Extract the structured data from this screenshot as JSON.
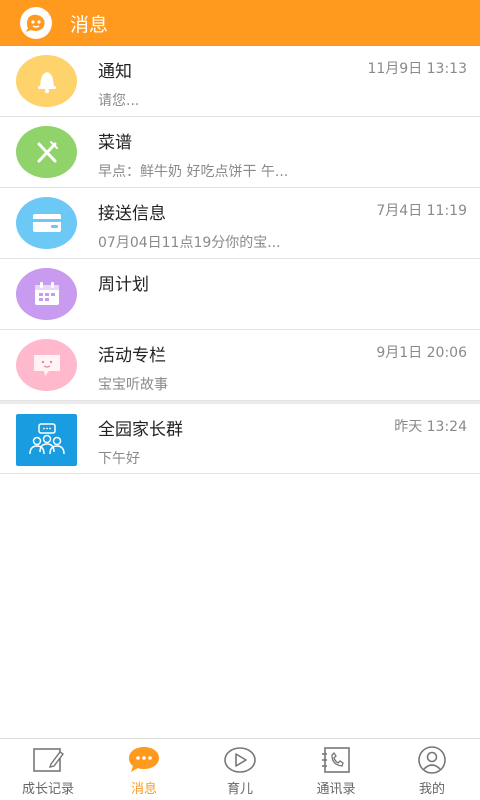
{
  "header": {
    "title": "消息"
  },
  "conversations": [
    {
      "title": "通知",
      "time": "11月9日 13:13",
      "preview": "请您...",
      "color": "#ffd36b",
      "icon": "bell-icon"
    },
    {
      "title": "菜谱",
      "time": "",
      "preview": "早点：鲜牛奶 好吃点饼干 午...",
      "color": "#8fd36a",
      "icon": "fork-knife-icon"
    },
    {
      "title": "接送信息",
      "time": "7月4日 11:19",
      "preview": "07月04日11点19分你的宝...",
      "color": "#6cc8f5",
      "icon": "card-icon"
    },
    {
      "title": "周计划",
      "time": "",
      "preview": "",
      "color": "#c89af0",
      "icon": "calendar-icon"
    },
    {
      "title": "活动专栏",
      "time": "9月1日 20:06",
      "preview": "宝宝听故事",
      "color": "#ffb8cc",
      "icon": "chat-bubble-icon"
    },
    {
      "title": "全园家长群",
      "time": "昨天 13:24",
      "preview": "下午好",
      "color": "#1a9de0",
      "icon": "group-icon"
    }
  ],
  "tabs": [
    {
      "label": "成长记录",
      "icon": "edit-icon",
      "active": false
    },
    {
      "label": "消息",
      "icon": "message-icon",
      "active": true
    },
    {
      "label": "育儿",
      "icon": "play-icon",
      "active": false
    },
    {
      "label": "通讯录",
      "icon": "phone-book-icon",
      "active": false
    },
    {
      "label": "我的",
      "icon": "person-icon",
      "active": false
    }
  ],
  "colors": {
    "accent": "#ff9a1f"
  }
}
